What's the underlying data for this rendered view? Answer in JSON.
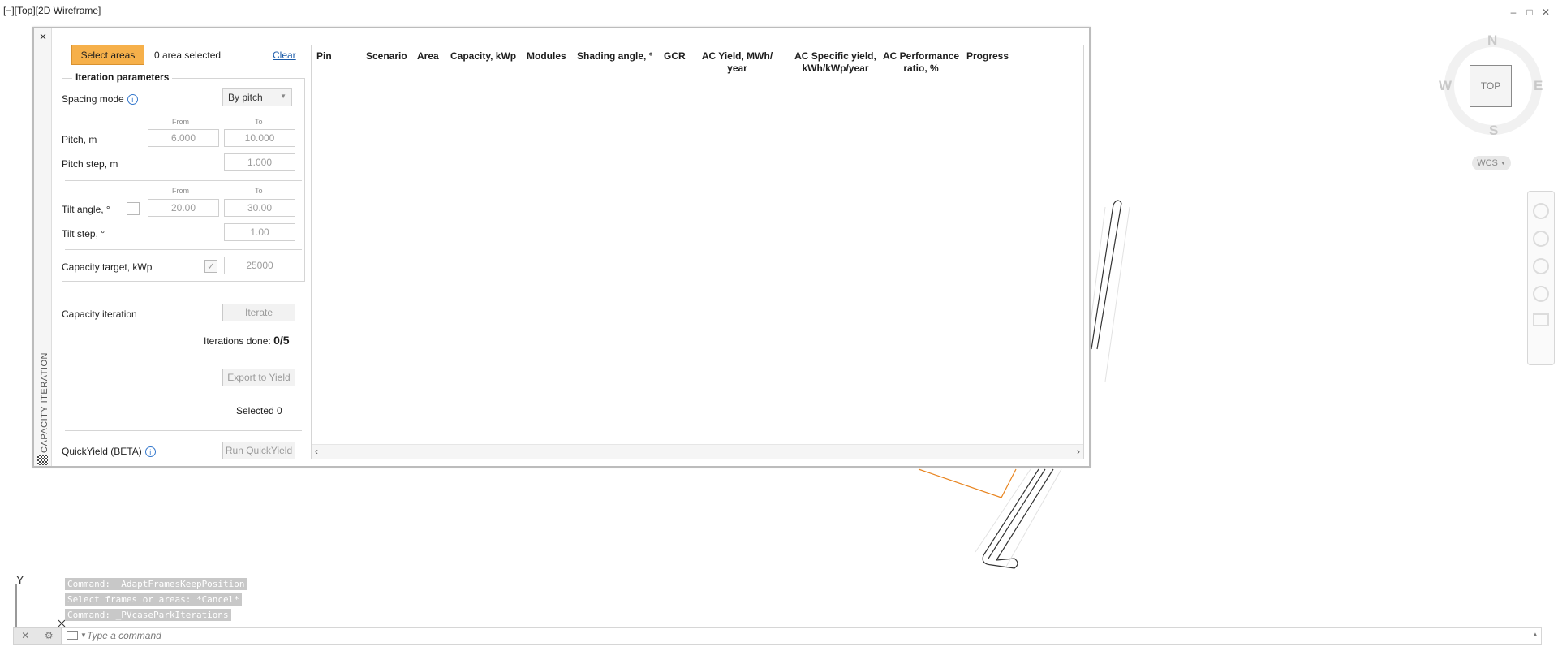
{
  "viewport": {
    "label": "[−][Top][2D Wireframe]",
    "window_controls": [
      "–",
      "□",
      "✕"
    ]
  },
  "viewcube": {
    "top": "TOP",
    "north": "N",
    "south": "S",
    "east": "E",
    "west": "W",
    "wcs": "WCS"
  },
  "palette": {
    "close": "×",
    "title": "CAPACITY ITERATION",
    "select_areas": "Select areas",
    "area_selected": "0 area selected",
    "clear": "Clear",
    "iteration_parameters": "Iteration parameters",
    "spacing_mode_label": "Spacing mode",
    "spacing_mode_value": "By pitch",
    "from": "From",
    "to": "To",
    "pitch_label": "Pitch, m",
    "pitch_from": "6.000",
    "pitch_to": "10.000",
    "pitch_step_label": "Pitch step, m",
    "pitch_step": "1.000",
    "tilt_label": "Tilt angle, °",
    "tilt_from": "20.00",
    "tilt_to": "30.00",
    "tilt_step_label": "Tilt step, °",
    "tilt_step": "1.00",
    "capacity_target_label": "Capacity target, kWp",
    "capacity_target_checked": true,
    "capacity_target": "25000",
    "capacity_iteration_label": "Capacity iteration",
    "iterate": "Iterate",
    "iterations_done_label": "Iterations done:",
    "iterations_done": "0/5",
    "export_to_yield": "Export to Yield",
    "selected": "Selected 0",
    "quickyield_label": "QuickYield (BETA)",
    "run_quickyield": "Run QuickYield"
  },
  "table": {
    "columns": [
      "Pin",
      "Scenario",
      "Area",
      "Capacity, kWp",
      "Modules",
      "Shading angle, °",
      "GCR",
      "AC Yield, MWh/ year",
      "AC Specific yield, kWh/kWp/year",
      "AC Performance ratio, %",
      "Progress"
    ],
    "rows": []
  },
  "command": {
    "history": [
      "Command: _AdaptFramesKeepPosition",
      "Select frames or areas: *Cancel*",
      "Command: _PVcaseParkIterations"
    ],
    "placeholder": "Type a command"
  },
  "ucs": {
    "y_axis": "Y"
  },
  "colors": {
    "accent": "#f6b04a",
    "link": "#1a5aa8",
    "boundary": "#e8841f"
  }
}
